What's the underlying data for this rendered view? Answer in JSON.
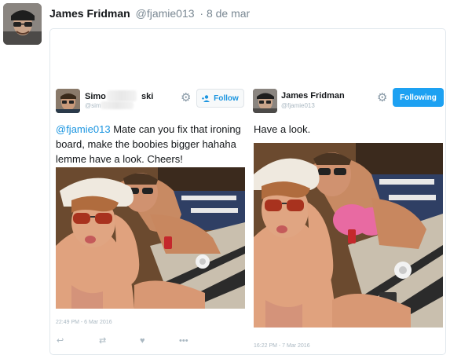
{
  "tweet": {
    "author_name": "James Fridman",
    "author_handle": "@fjamie013",
    "date": "· 8 de mar"
  },
  "left_panel": {
    "name_visible_start": "Simo",
    "name_visible_end": "ski",
    "handle_visible": "@sim",
    "follow_label": "Follow",
    "mention": "@fjamie013",
    "text": " Mate can you fix that ironing board, make the boobies bigger hahaha lemme have a look. Cheers!",
    "timestamp": "22:49 PM - 6 Mar 2016",
    "action_icons": [
      "reply-icon",
      "retweet-icon",
      "like-icon",
      "more-icon"
    ]
  },
  "right_panel": {
    "name": "James Fridman",
    "handle": "@fjamie013",
    "following_label": "Following",
    "text": "Have a look.",
    "timestamp": "16:22 PM - 7 Mar 2016"
  },
  "colors": {
    "link_blue": "#1b95e0",
    "button_blue": "#1da1f2",
    "muted_text": "#7a8893"
  }
}
